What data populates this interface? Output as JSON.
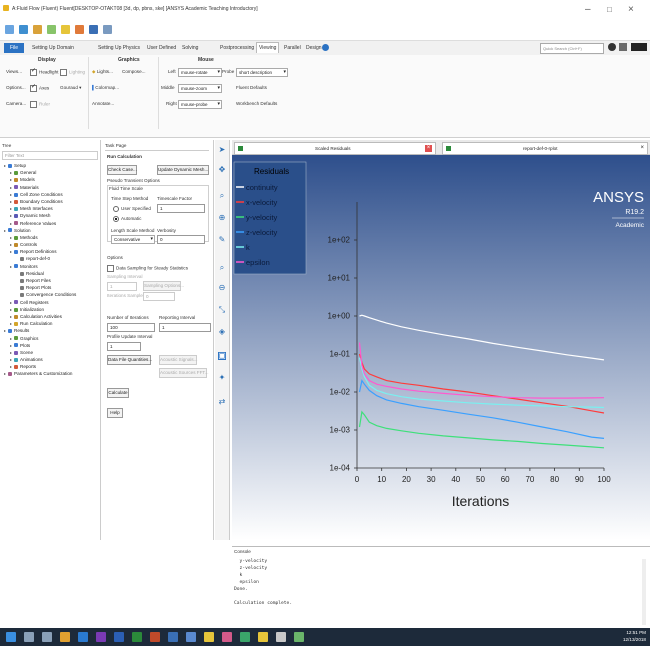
{
  "window": {
    "title": "A:Fluid Flow (Fluent) Fluent[DESKTOP-OTAKT08 [3d, dp, pbns, ske] [ANSYS Academic Teaching Introductory]",
    "minimize": "–",
    "maximize": "□",
    "close": "×"
  },
  "ribbon_tabs": [
    {
      "label": "File"
    },
    {
      "label": "Setting Up Domain"
    },
    {
      "label": "Setting Up Physics"
    },
    {
      "label": "User Defined"
    },
    {
      "label": "Solving"
    },
    {
      "label": "Postprocessing"
    },
    {
      "label": "Viewing",
      "active": true
    },
    {
      "label": "Parallel"
    },
    {
      "label": "Design"
    }
  ],
  "quick_search": {
    "placeholder": "Quick Search (Ctrl+F)"
  },
  "ribbon": {
    "display": {
      "title": "Display",
      "views": "Views...",
      "headlight": "Headlight",
      "lighting": "Lighting",
      "options": "Options...",
      "axes": "Axes",
      "gouraud": "Gouraud",
      "camera": "Camera...",
      "ruler": "Ruler"
    },
    "graphics": {
      "title": "Graphics",
      "lights": "Lights...",
      "compose": "Compose...",
      "colormap": "Colormap...",
      "annotate": "Annotate..."
    },
    "mouse": {
      "title": "Mouse",
      "left_label": "Left",
      "left_value": "mouse-rotate",
      "middle_label": "Middle",
      "middle_value": "mouse-zoom",
      "right_label": "Right",
      "right_value": "mouse-probe",
      "probe_label": "Probe",
      "probe_value": "short description",
      "fluent_defaults": "Fluent Defaults",
      "workbench_defaults": "Workbench Defaults"
    }
  },
  "tree": {
    "header": "Tree",
    "filter_placeholder": "Filter Text",
    "items": [
      {
        "label": "Setup",
        "indent": 0,
        "color": "#3a7bd5"
      },
      {
        "label": "General",
        "indent": 1,
        "color": "#5a9b3a"
      },
      {
        "label": "Models",
        "indent": 1,
        "color": "#c08a2a"
      },
      {
        "label": "Materials",
        "indent": 1,
        "color": "#7a5ab5"
      },
      {
        "label": "Cell Zone Conditions",
        "indent": 1,
        "color": "#3a7bd5"
      },
      {
        "label": "Boundary Conditions",
        "indent": 1,
        "color": "#d35a3a"
      },
      {
        "label": "Mesh Interfaces",
        "indent": 1,
        "color": "#3aa5b5"
      },
      {
        "label": "Dynamic Mesh",
        "indent": 1,
        "color": "#5a5ab5"
      },
      {
        "label": "Reference Values",
        "indent": 1,
        "color": "#a55a8a"
      },
      {
        "label": "Solution",
        "indent": 0,
        "color": "#3a7bd5"
      },
      {
        "label": "Methods",
        "indent": 1,
        "color": "#5a9b3a"
      },
      {
        "label": "Controls",
        "indent": 1,
        "color": "#c08a2a"
      },
      {
        "label": "Report Definitions",
        "indent": 1,
        "color": "#3a7bd5"
      },
      {
        "label": "report-def-0",
        "indent": 2,
        "color": "#7a7a7a"
      },
      {
        "label": "Monitors",
        "indent": 1,
        "color": "#3a7bd5"
      },
      {
        "label": "Residual",
        "indent": 2,
        "color": "#7a7a7a"
      },
      {
        "label": "Report Files",
        "indent": 2,
        "color": "#7a7a7a"
      },
      {
        "label": "Report Plots",
        "indent": 2,
        "color": "#7a7a7a"
      },
      {
        "label": "Convergence Conditions",
        "indent": 2,
        "color": "#7a7a7a"
      },
      {
        "label": "Cell Registers",
        "indent": 1,
        "color": "#7a5ab5"
      },
      {
        "label": "Initialization",
        "indent": 1,
        "color": "#5a9b3a"
      },
      {
        "label": "Calculation Activities",
        "indent": 1,
        "color": "#c08a2a"
      },
      {
        "label": "Run Calculation",
        "indent": 1,
        "color": "#d3a52a"
      },
      {
        "label": "Results",
        "indent": 0,
        "color": "#3a7bd5"
      },
      {
        "label": "Graphics",
        "indent": 1,
        "color": "#5a9b3a"
      },
      {
        "label": "Plots",
        "indent": 1,
        "color": "#3a7bd5"
      },
      {
        "label": "Scene",
        "indent": 1,
        "color": "#7a5ab5"
      },
      {
        "label": "Animations",
        "indent": 1,
        "color": "#3aa5b5"
      },
      {
        "label": "Reports",
        "indent": 1,
        "color": "#d35a3a"
      },
      {
        "label": "Parameters & Customization",
        "indent": 0,
        "color": "#a55a8a"
      }
    ]
  },
  "task": {
    "header": "Task Page",
    "title": "Run Calculation",
    "check_case": "Check Case...",
    "update_mesh": "Update Dynamic Mesh...",
    "pseudo_label": "Pseudo Transient Options",
    "fluid_time_scale": "Fluid Time Scale",
    "time_step_method": "Time Step Method",
    "timescale_factor": "Timescale Factor",
    "user_specified": "User Specified",
    "automatic": "Automatic",
    "timescale_value": "1",
    "length_scale_method": "Length Scale Method",
    "verbosity": "Verbosity",
    "length_scale_value": "Conservative",
    "verbosity_value": "0",
    "options": "Options",
    "data_sampling": "Data Sampling for Steady Statistics",
    "sampling_interval": "Sampling Interval",
    "sampling_interval_value": "1",
    "sampling_options": "Sampling Options...",
    "iterations_sampled": "Iterations Sampled",
    "iterations_sampled_value": "0",
    "number_of_iterations": "Number of Iterations",
    "reporting_interval": "Reporting Interval",
    "iterations_value": "100",
    "reporting_value": "1",
    "profile_update_interval": "Profile Update Interval",
    "profile_value": "1",
    "data_file_quantities": "Data File Quantities...",
    "acoustic_signals": "Acoustic Signals...",
    "acoustic_sources": "Acoustic Sources FFT...",
    "calculate": "Calculate",
    "help": "Help"
  },
  "graphics": {
    "tab1": "Scaled Residuals",
    "tab2": "report-def-0-rplot",
    "logo": "ANSYS",
    "version": "R19.2",
    "edition": "Academic"
  },
  "chart_data": {
    "type": "line",
    "title": "",
    "xlabel": "Iterations",
    "ylabel": "",
    "xlim": [
      0,
      100
    ],
    "ylim": [
      0.0001,
      1000
    ],
    "yscale": "log",
    "xticks": [
      "0",
      "10",
      "20",
      "30",
      "40",
      "50",
      "60",
      "70",
      "80",
      "90",
      "100"
    ],
    "yticks": [
      "1e+02",
      "1e+01",
      "1e+00",
      "1e-01",
      "1e-02",
      "1e-03",
      "1e-04"
    ],
    "legend": {
      "title": "Residuals",
      "position": "top-left"
    },
    "series": [
      {
        "name": "continuity",
        "color": "#ffffff",
        "x": [
          1,
          2,
          3,
          5,
          8,
          12,
          18,
          25,
          35,
          45,
          55,
          65,
          75,
          85,
          95,
          100
        ],
        "y": [
          1.0,
          1.05,
          1.0,
          0.9,
          0.78,
          0.65,
          0.52,
          0.42,
          0.32,
          0.25,
          0.19,
          0.15,
          0.12,
          0.095,
          0.078,
          0.07
        ]
      },
      {
        "name": "x-velocity",
        "color": "#ff3b3b",
        "x": [
          1,
          2,
          3,
          5,
          8,
          12,
          18,
          25,
          35,
          45,
          55,
          65,
          75,
          85,
          95,
          100
        ],
        "y": [
          0.1,
          0.06,
          0.04,
          0.03,
          0.025,
          0.02,
          0.017,
          0.015,
          0.012,
          0.01,
          0.008,
          0.0065,
          0.0052,
          0.0042,
          0.0032,
          0.0028
        ]
      },
      {
        "name": "y-velocity",
        "color": "#3ee07a",
        "x": [
          1,
          2,
          3,
          5,
          8,
          12,
          18,
          25,
          35,
          45,
          55,
          65,
          75,
          85,
          95,
          100
        ],
        "y": [
          0.0012,
          0.003,
          0.0025,
          0.0016,
          0.0013,
          0.0011,
          0.00095,
          0.00082,
          0.0007,
          0.00062,
          0.00055,
          0.0005,
          0.00044,
          0.0004,
          0.00036,
          0.00034
        ]
      },
      {
        "name": "z-velocity",
        "color": "#3aa0ff",
        "x": [
          1,
          2,
          3,
          5,
          8,
          12,
          18,
          25,
          35,
          45,
          55,
          65,
          75,
          85,
          95,
          100
        ],
        "y": [
          0.01,
          0.02,
          0.016,
          0.011,
          0.008,
          0.0062,
          0.005,
          0.0041,
          0.0033,
          0.0026,
          0.0021,
          0.0016,
          0.0012,
          0.0009,
          0.00065,
          0.0006
        ]
      },
      {
        "name": "k",
        "color": "#7af0f0",
        "x": [
          1,
          2,
          3,
          5,
          8,
          12,
          18,
          25,
          35,
          45,
          55,
          65,
          75,
          85,
          95,
          100
        ],
        "y": [
          0.08,
          0.04,
          0.025,
          0.015,
          0.011,
          0.009,
          0.0075,
          0.0065,
          0.0058,
          0.0052,
          0.0048,
          0.0045,
          0.0043,
          0.0041,
          0.004,
          0.0039
        ]
      },
      {
        "name": "epsilon",
        "color": "#ff5ad0",
        "x": [
          1,
          2,
          3,
          5,
          8,
          12,
          18,
          25,
          35,
          45,
          55,
          65,
          75,
          85,
          95,
          100
        ],
        "y": [
          0.2,
          0.05,
          0.03,
          0.02,
          0.016,
          0.014,
          0.012,
          0.0105,
          0.0092,
          0.0082,
          0.0075,
          0.0071,
          0.0069,
          0.0069,
          0.007,
          0.0071
        ]
      }
    ]
  },
  "console": {
    "header": "Console",
    "lines": [
      "  y-velocity",
      "  z-velocity",
      "  k",
      "  epsilon",
      "Done.",
      "",
      "Calculation complete."
    ]
  },
  "taskbar": {
    "time": "12:51 PM",
    "date": "12/13/2018"
  }
}
